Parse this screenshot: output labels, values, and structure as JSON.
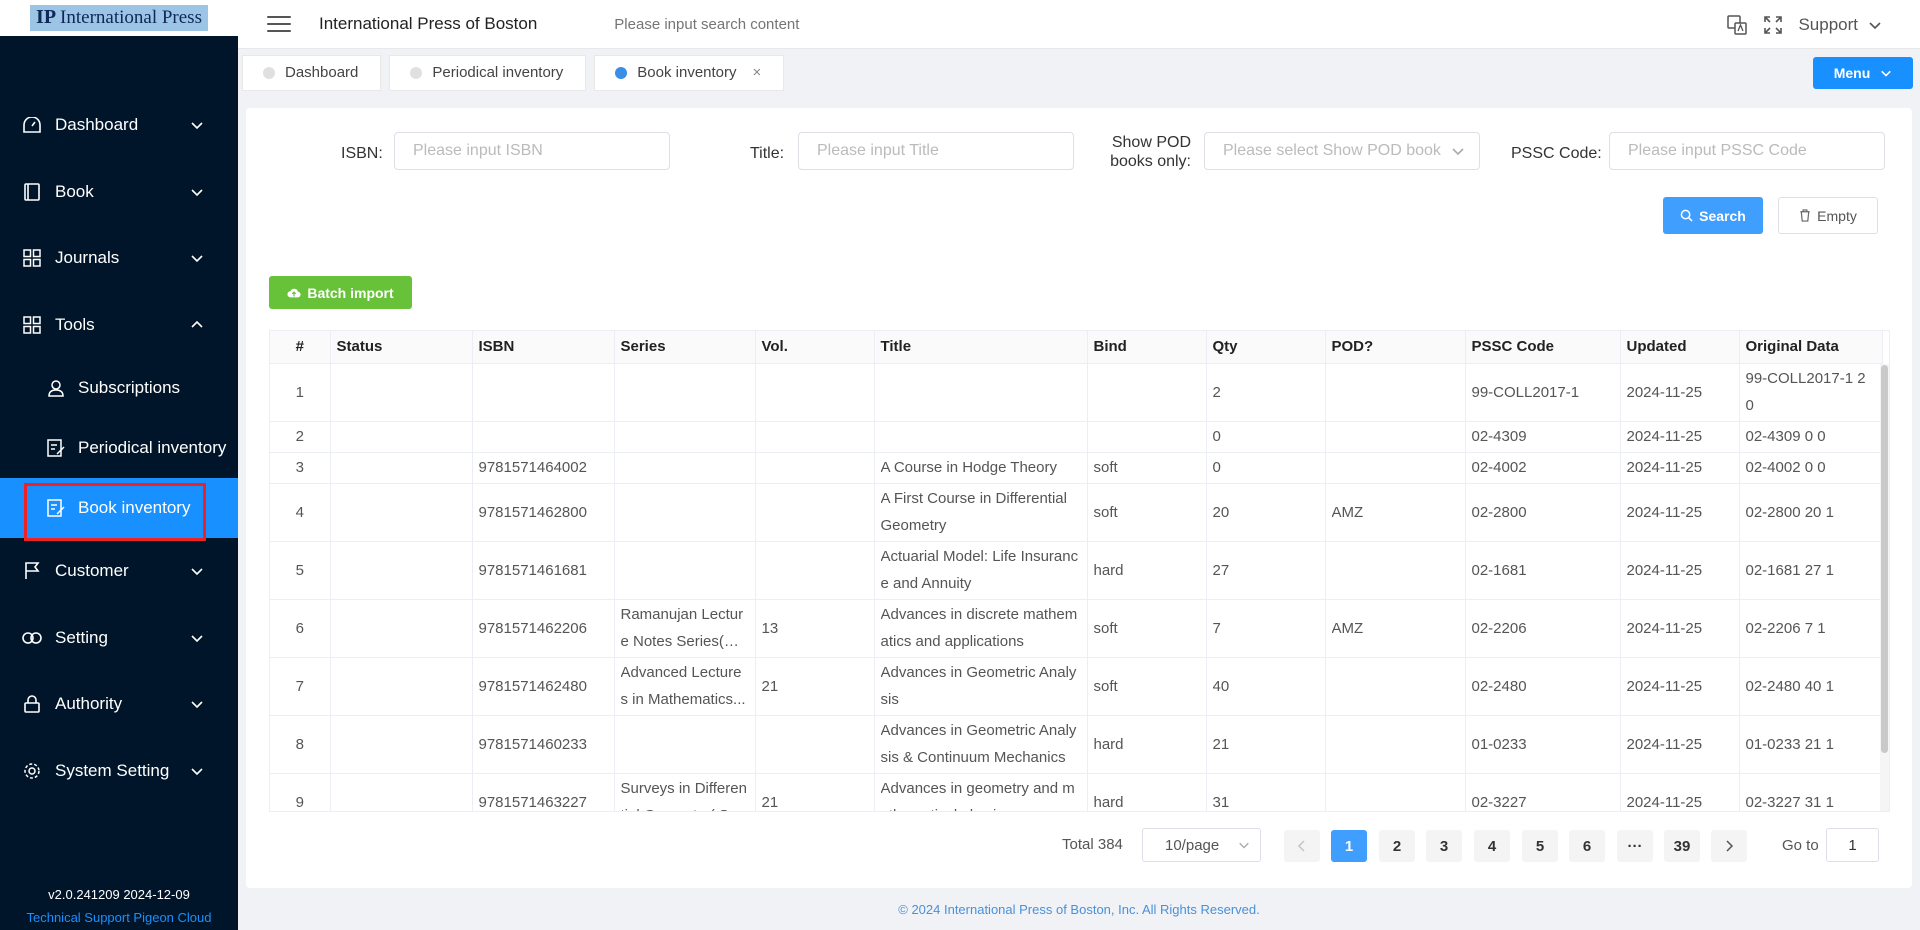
{
  "logo": {
    "text": "International Press",
    "mark": "IP"
  },
  "sidebar": {
    "items": [
      {
        "label": "Dashboard",
        "icon": "dashboard-icon"
      },
      {
        "label": "Book",
        "icon": "book-icon"
      },
      {
        "label": "Journals",
        "icon": "grid-icon"
      },
      {
        "label": "Tools",
        "icon": "grid-icon",
        "expanded": true
      }
    ],
    "subitems": [
      {
        "label": "Subscriptions",
        "icon": "user-icon"
      },
      {
        "label": "Periodical inventory",
        "icon": "edit-icon"
      },
      {
        "label": "Book inventory",
        "icon": "edit-icon",
        "active": true
      }
    ],
    "items_after": [
      {
        "label": "Customer",
        "icon": "flag-icon"
      },
      {
        "label": "Setting",
        "icon": "link-icon"
      },
      {
        "label": "Authority",
        "icon": "lock-icon"
      },
      {
        "label": "System Setting",
        "icon": "gear-icon"
      }
    ],
    "version": "v2.0.241209 2024-12-09",
    "tech_support": "Technical Support Pigeon Cloud"
  },
  "header": {
    "title": "International Press of Boston",
    "search_placeholder": "Please input search content",
    "support": "Support"
  },
  "tabs": [
    {
      "label": "Dashboard",
      "active": false
    },
    {
      "label": "Periodical inventory",
      "active": false
    },
    {
      "label": "Book inventory",
      "active": true,
      "closable": true
    }
  ],
  "tabs_close": "×",
  "menu_button": "Menu",
  "filters": {
    "isbn_label": "ISBN:",
    "isbn_placeholder": "Please input ISBN",
    "title_label": "Title:",
    "title_placeholder": "Please input Title",
    "pod_label_1": "Show POD",
    "pod_label_2": "books only:",
    "pod_placeholder": "Please select Show POD book",
    "pssc_label": "PSSC Code:",
    "pssc_placeholder": "Please input PSSC Code"
  },
  "buttons": {
    "search": "Search",
    "empty": "Empty",
    "batch_import": "Batch import"
  },
  "table": {
    "columns": [
      "#",
      "Status",
      "ISBN",
      "Series",
      "Vol.",
      "Title",
      "Bind",
      "Qty",
      "POD?",
      "PSSC Code",
      "Updated",
      "Original Data"
    ],
    "rows": [
      {
        "num": "1",
        "status": "",
        "isbn": "",
        "series": "",
        "vol": "",
        "title": "",
        "bind": "",
        "qty": "2",
        "pod": "",
        "pssc": "99-COLL2017-1",
        "updated": "2024-11-25",
        "orig": "99-COLL2017-1 2 0"
      },
      {
        "num": "2",
        "status": "",
        "isbn": "",
        "series": "",
        "vol": "",
        "title": "",
        "bind": "",
        "qty": "0",
        "pod": "",
        "pssc": "02-4309",
        "updated": "2024-11-25",
        "orig": "02-4309 0 0"
      },
      {
        "num": "3",
        "status": "",
        "isbn": "9781571464002",
        "series": "",
        "vol": "",
        "title": "A Course in Hodge Theory",
        "bind": "soft",
        "qty": "0",
        "pod": "",
        "pssc": "02-4002",
        "updated": "2024-11-25",
        "orig": "02-4002 0 0"
      },
      {
        "num": "4",
        "status": "",
        "isbn": "9781571462800",
        "series": "",
        "vol": "",
        "title": "A First Course in Differential Geometry",
        "bind": "soft",
        "qty": "20",
        "pod": "AMZ",
        "pssc": "02-2800",
        "updated": "2024-11-25",
        "orig": "02-2800 20 1"
      },
      {
        "num": "5",
        "status": "",
        "isbn": "9781571461681",
        "series": "",
        "vol": "",
        "title": "Actuarial Model: Life Insurance and Annuity",
        "bind": "hard",
        "qty": "27",
        "pod": "",
        "pssc": "02-1681",
        "updated": "2024-11-25",
        "orig": "02-1681 27 1"
      },
      {
        "num": "6",
        "status": "",
        "isbn": "9781571462206",
        "series": "Ramanujan Lecture Notes Series( R...",
        "vol": "13",
        "title": "Advances in discrete mathematics and applications",
        "bind": "soft",
        "qty": "7",
        "pod": "AMZ",
        "pssc": "02-2206",
        "updated": "2024-11-25",
        "orig": "02-2206 7 1"
      },
      {
        "num": "7",
        "status": "",
        "isbn": "9781571462480",
        "series": "Advanced Lectures in Mathematics...",
        "vol": "21",
        "title": "Advances in Geometric Analysis",
        "bind": "soft",
        "qty": "40",
        "pod": "",
        "pssc": "02-2480",
        "updated": "2024-11-25",
        "orig": "02-2480 40 1"
      },
      {
        "num": "8",
        "status": "",
        "isbn": "9781571460233",
        "series": "",
        "vol": "",
        "title": "Advances in Geometric Analysis & Continuum Mechanics",
        "bind": "hard",
        "qty": "21",
        "pod": "",
        "pssc": "01-0233",
        "updated": "2024-11-25",
        "orig": "01-0233 21 1"
      },
      {
        "num": "9",
        "status": "",
        "isbn": "9781571463227",
        "series": "Surveys in Differential Geometry( S...",
        "vol": "21",
        "title": "Advances in geometry and mathematical physics",
        "bind": "hard",
        "qty": "31",
        "pod": "",
        "pssc": "02-3227",
        "updated": "2024-11-25",
        "orig": "02-3227 31 1"
      }
    ]
  },
  "pagination": {
    "total": "Total 384",
    "page_size": "10/page",
    "pages": [
      "1",
      "2",
      "3",
      "4",
      "5",
      "6",
      "···",
      "39"
    ],
    "current": "1",
    "goto_label": "Go to",
    "goto_value": "1"
  },
  "footer": "© 2024 International Press of Boston, Inc. All Rights Reserved.",
  "colors": {
    "sidebar": "#001529",
    "primary": "#1890ff",
    "success": "#67c23a"
  }
}
